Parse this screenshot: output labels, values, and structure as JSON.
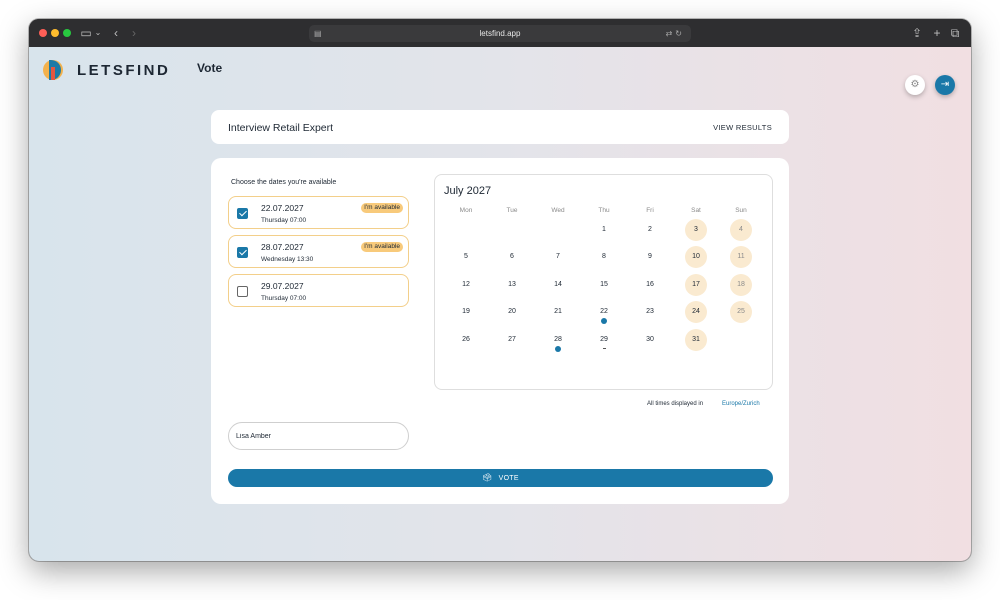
{
  "browser": {
    "url": "letsfind.app"
  },
  "nav": {
    "brand": "LETSFIND",
    "title": "Vote"
  },
  "poll": {
    "title": "Interview Retail Expert",
    "view_results": "VIEW RESULTS",
    "choose_label": "Choose the dates you're available",
    "options": [
      {
        "date": "22.07.2027",
        "detail": "Thursday 07:00",
        "checked": true,
        "badge": "I'm available"
      },
      {
        "date": "28.07.2027",
        "detail": "Wednesday 13:30",
        "checked": true,
        "badge": "I'm available"
      },
      {
        "date": "29.07.2027",
        "detail": "Thursday 07:00",
        "checked": false,
        "badge": ""
      }
    ]
  },
  "calendar": {
    "month": "July 2027",
    "weekdays": [
      "Mon",
      "Tue",
      "Wed",
      "Thu",
      "Fri",
      "Sat",
      "Sun"
    ],
    "first_weekday_index": 3,
    "days_in_month": 31,
    "marked_days": [
      22,
      28
    ],
    "minor_marked_days": [
      29
    ]
  },
  "timezone": {
    "label": "All times displayed in",
    "value": "Europe/Zurich"
  },
  "name_field": {
    "value": "Lisa Amber"
  },
  "vote_button": {
    "label": "VOTE"
  }
}
